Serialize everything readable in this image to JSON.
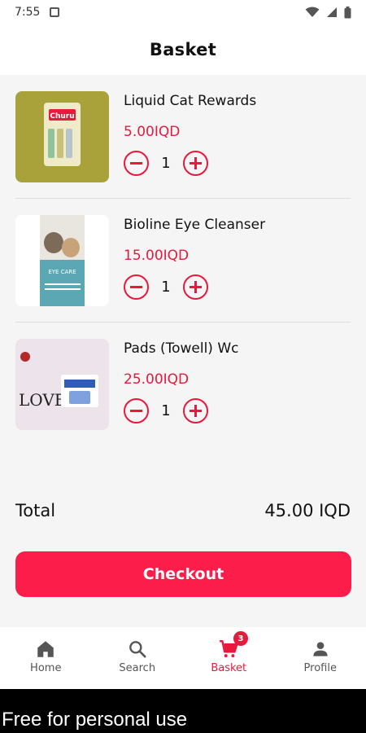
{
  "status_bar": {
    "time": "7:55"
  },
  "header": {
    "title": "Basket"
  },
  "cart": {
    "items": [
      {
        "name": "Liquid Cat Rewards",
        "price": "5.00IQD",
        "quantity": "1",
        "thumb_label": "Churu"
      },
      {
        "name": "Bioline Eye Cleanser",
        "price": "15.00IQD",
        "quantity": "1",
        "thumb_label": "EYE CARE"
      },
      {
        "name": "Pads (Towell) Wc",
        "price": "25.00IQD",
        "quantity": "1",
        "thumb_label": "LOVE"
      }
    ]
  },
  "summary": {
    "total_label": "Total",
    "total_value": "45.00 IQD"
  },
  "checkout": {
    "label": "Checkout"
  },
  "nav": {
    "items": [
      {
        "label": "Home",
        "icon": "home-icon"
      },
      {
        "label": "Search",
        "icon": "search-icon"
      },
      {
        "label": "Basket",
        "icon": "cart-icon",
        "badge": "3"
      },
      {
        "label": "Profile",
        "icon": "person-icon"
      }
    ],
    "active": "Basket"
  },
  "footer": {
    "text": "Free for personal use"
  },
  "colors": {
    "accent": "#e8193c",
    "button": "#fd1d4a",
    "background": "#f5f5f5"
  }
}
